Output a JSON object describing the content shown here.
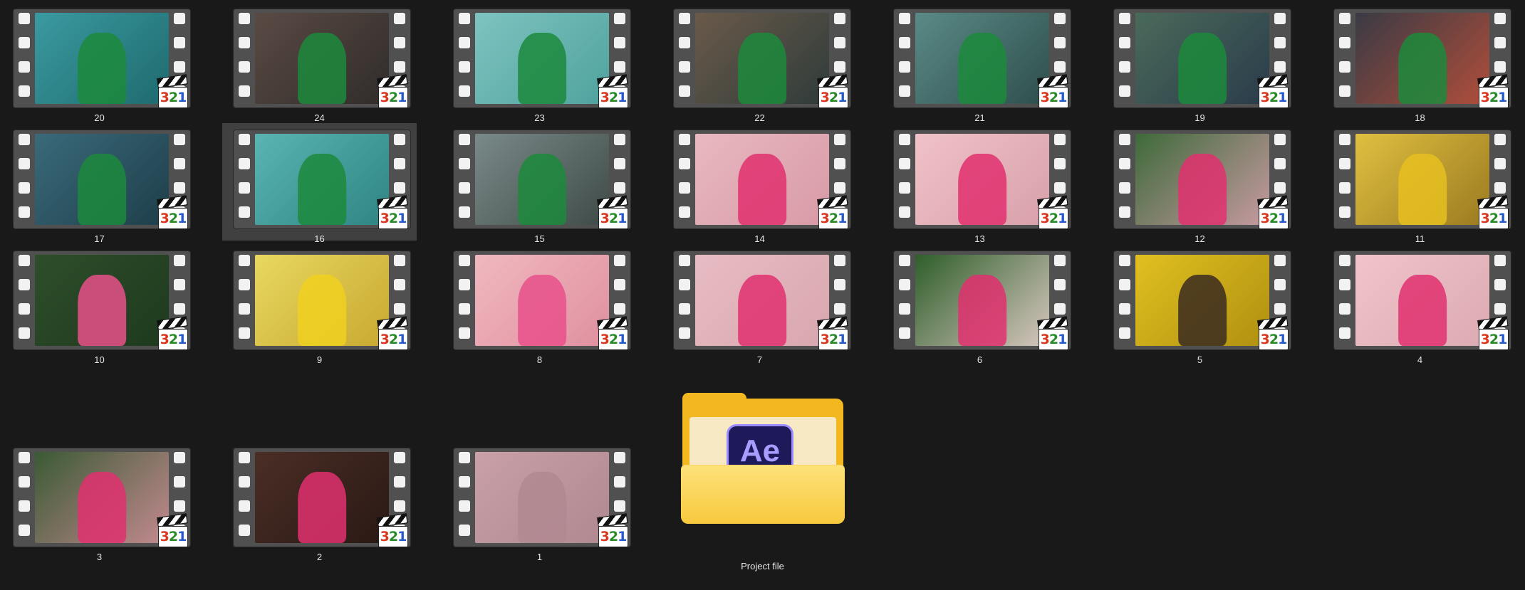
{
  "items": [
    {
      "label": "20",
      "thumb": [
        "#3a9aa0",
        "#1e6a6e"
      ],
      "figure": "#1c8a3c"
    },
    {
      "label": "24",
      "thumb": [
        "#5a4a44",
        "#302c2a"
      ],
      "figure": "#1c8a3c"
    },
    {
      "label": "23",
      "thumb": [
        "#7ec3c0",
        "#4fa29e"
      ],
      "figure": "#1c8a3c"
    },
    {
      "label": "22",
      "thumb": [
        "#6a5a4a",
        "#2f3b3a"
      ],
      "figure": "#1c8a3c"
    },
    {
      "label": "21",
      "thumb": [
        "#5a8a86",
        "#2e4e4c"
      ],
      "figure": "#1c8a3c"
    },
    {
      "label": "19",
      "thumb": [
        "#4a6a5a",
        "#2a3b4a"
      ],
      "figure": "#1c8a3c"
    },
    {
      "label": "18",
      "thumb": [
        "#3a3a44",
        "#b04e3a"
      ],
      "figure": "#1c8a3c"
    },
    {
      "label": "17",
      "thumb": [
        "#3a6a7a",
        "#1e3e4a"
      ],
      "figure": "#1c8a3c"
    },
    {
      "label": "16",
      "thumb": [
        "#5ab5b2",
        "#2e8482"
      ],
      "figure": "#1c8a3c",
      "selected": true
    },
    {
      "label": "15",
      "thumb": [
        "#7a8a88",
        "#3e4a48"
      ],
      "figure": "#1c8a3c"
    },
    {
      "label": "14",
      "thumb": [
        "#e8b8c0",
        "#d89aa6"
      ],
      "figure": "#e0306e"
    },
    {
      "label": "13",
      "thumb": [
        "#f0c2c8",
        "#d8a0aa"
      ],
      "figure": "#e0306e"
    },
    {
      "label": "12",
      "thumb": [
        "#3e6a3a",
        "#c89aa2"
      ],
      "figure": "#e0306e"
    },
    {
      "label": "11",
      "thumb": [
        "#e0c040",
        "#9a7a20"
      ],
      "figure": "#e6c020"
    },
    {
      "label": "10",
      "thumb": [
        "#2e4e2a",
        "#1e3a1e"
      ],
      "figure": "#e8508a"
    },
    {
      "label": "9",
      "thumb": [
        "#e8d860",
        "#c8a830"
      ],
      "figure": "#f0d020"
    },
    {
      "label": "8",
      "thumb": [
        "#f0b8c0",
        "#e090a0"
      ],
      "figure": "#e8508a"
    },
    {
      "label": "7",
      "thumb": [
        "#e8bcc4",
        "#d8a6ae"
      ],
      "figure": "#e0306e"
    },
    {
      "label": "6",
      "thumb": [
        "#2e5e2a",
        "#d8c8c0"
      ],
      "figure": "#e0306e"
    },
    {
      "label": "5",
      "thumb": [
        "#e0c020",
        "#b09010"
      ],
      "figure": "#3a2a20"
    },
    {
      "label": "4",
      "thumb": [
        "#f0c4ca",
        "#dcaab2"
      ],
      "figure": "#e0306e"
    },
    {
      "label": "3",
      "thumb": [
        "#3a5a34",
        "#c48a90"
      ],
      "figure": "#e0306e"
    },
    {
      "label": "2",
      "thumb": [
        "#4a2e26",
        "#2a1814"
      ],
      "figure": "#e0306e"
    },
    {
      "label": "1",
      "thumb": [
        "#c8a0a6",
        "#b08890"
      ],
      "figure": "#b08890"
    }
  ],
  "folder": {
    "label": "Project file",
    "icon": "after-effects-icon",
    "icon_text": "Ae"
  },
  "badge": {
    "icon": "media-player-classic-icon",
    "digits": [
      "3",
      "2",
      "1"
    ]
  }
}
